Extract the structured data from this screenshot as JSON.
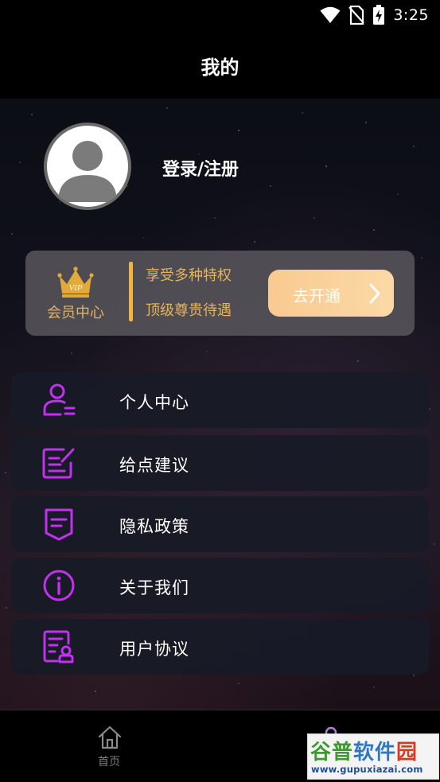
{
  "status_bar": {
    "time": "3:25",
    "icons": [
      "wifi-icon",
      "no-sim-icon",
      "battery-charging-icon"
    ]
  },
  "header": {
    "title": "我的"
  },
  "profile": {
    "login_label": "登录/注册",
    "avatar_icon": "user-avatar-icon"
  },
  "vip": {
    "badge_text": "VIP",
    "title": "会员中心",
    "perks": [
      "享受多种特权",
      "顶级尊贵待遇"
    ],
    "button_label": "去开通",
    "accent_color": "#e6b35a"
  },
  "menu": {
    "icon_color": "#c230f0",
    "items": [
      {
        "label": "个人中心",
        "icon": "user-profile-icon"
      },
      {
        "label": "给点建议",
        "icon": "feedback-edit-icon"
      },
      {
        "label": "隐私政策",
        "icon": "privacy-doc-icon"
      },
      {
        "label": "关于我们",
        "icon": "info-icon"
      },
      {
        "label": "用户协议",
        "icon": "user-agreement-icon"
      }
    ]
  },
  "bottom_nav": {
    "items": [
      {
        "label": "首页",
        "icon": "home-icon"
      },
      {
        "label": "",
        "icon": "mine-icon"
      }
    ]
  },
  "watermark": {
    "logo_text": [
      "谷普",
      "软件",
      "园"
    ],
    "url": "www.gupuxiazai.com"
  }
}
